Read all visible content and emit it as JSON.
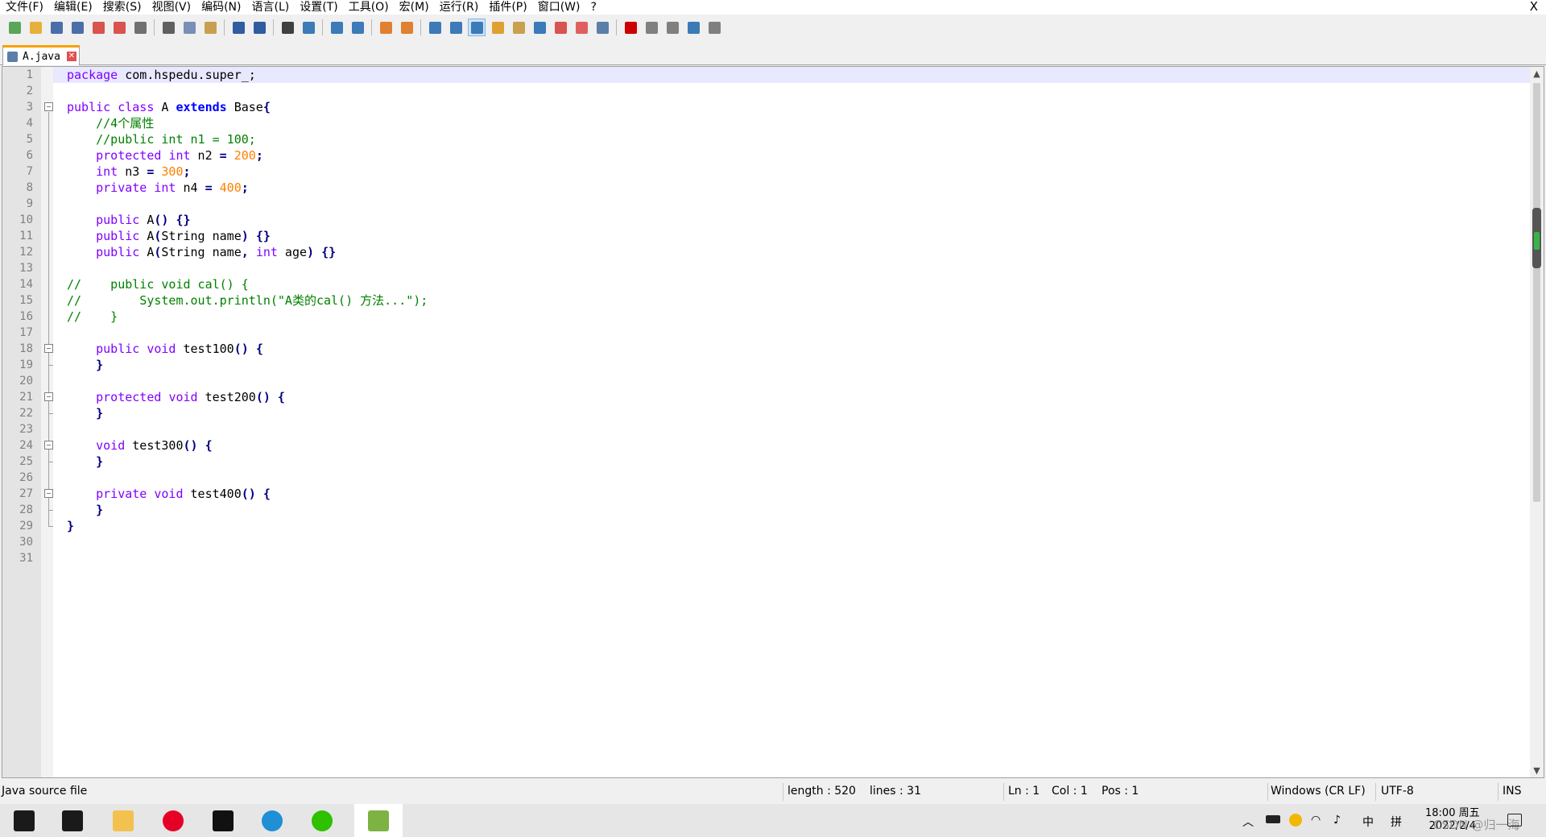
{
  "menu": {
    "items": [
      "文件(F)",
      "编辑(E)",
      "搜索(S)",
      "视图(V)",
      "编码(N)",
      "语言(L)",
      "设置(T)",
      "工具(O)",
      "宏(M)",
      "运行(R)",
      "插件(P)",
      "窗口(W)",
      "?"
    ],
    "close": "X"
  },
  "toolbar": {
    "icons": [
      {
        "name": "new-file-icon",
        "color": "#5aa55a"
      },
      {
        "name": "open-file-icon",
        "color": "#e6b13a"
      },
      {
        "name": "save-icon",
        "color": "#4a6fa8"
      },
      {
        "name": "save-all-icon",
        "color": "#4a6fa8"
      },
      {
        "name": "close-file-icon",
        "color": "#d9534f"
      },
      {
        "name": "close-all-icon",
        "color": "#d9534f"
      },
      {
        "name": "print-icon",
        "color": "#707070"
      },
      {
        "name": "sep"
      },
      {
        "name": "cut-icon",
        "color": "#606060"
      },
      {
        "name": "copy-icon",
        "color": "#7a8fb5"
      },
      {
        "name": "paste-icon",
        "color": "#c8a050"
      },
      {
        "name": "sep"
      },
      {
        "name": "undo-icon",
        "color": "#2f5d9f"
      },
      {
        "name": "redo-icon",
        "color": "#2f5d9f"
      },
      {
        "name": "sep"
      },
      {
        "name": "find-icon",
        "color": "#404040"
      },
      {
        "name": "replace-icon",
        "color": "#3c7ab8"
      },
      {
        "name": "sep"
      },
      {
        "name": "zoom-in-icon",
        "color": "#3c7ab8"
      },
      {
        "name": "zoom-out-icon",
        "color": "#3c7ab8"
      },
      {
        "name": "sep"
      },
      {
        "name": "sync-vertical-icon",
        "color": "#e08030"
      },
      {
        "name": "sync-horizontal-icon",
        "color": "#e08030"
      },
      {
        "name": "sep"
      },
      {
        "name": "word-wrap-icon",
        "color": "#3c7ab8"
      },
      {
        "name": "show-all-chars-icon",
        "color": "#3c7ab8"
      },
      {
        "name": "indent-guide-icon",
        "color": "#3c7ab8",
        "active": true
      },
      {
        "name": "udl-icon",
        "color": "#e0a030"
      },
      {
        "name": "doc-map-icon",
        "color": "#c8a050"
      },
      {
        "name": "function-list-icon",
        "color": "#3c7ab8"
      },
      {
        "name": "folder-workspace-icon",
        "color": "#d9534f"
      },
      {
        "name": "folder-icon",
        "color": "#e06060"
      },
      {
        "name": "monitoring-icon",
        "color": "#5a7fa8"
      },
      {
        "name": "sep"
      },
      {
        "name": "record-macro-icon",
        "color": "#cc0000"
      },
      {
        "name": "stop-record-icon",
        "color": "#808080"
      },
      {
        "name": "playback-macro-icon",
        "color": "#808080"
      },
      {
        "name": "run-macro-multiple-icon",
        "color": "#3c7ab8"
      },
      {
        "name": "save-macro-icon",
        "color": "#808080"
      }
    ]
  },
  "tab": {
    "name": "A.java",
    "close": "✕"
  },
  "code": {
    "lines": [
      [
        [
          "kw",
          "package"
        ],
        [
          "tx",
          " com.hspedu.super_;"
        ]
      ],
      [],
      [
        [
          "kw",
          "public"
        ],
        [
          "tx",
          " "
        ],
        [
          "kw",
          "class"
        ],
        [
          "tx",
          " A "
        ],
        [
          "kwb",
          "extends"
        ],
        [
          "tx",
          " Base"
        ],
        [
          "op",
          "{"
        ]
      ],
      [
        [
          "tx",
          "    "
        ],
        [
          "cm",
          "//4个属性"
        ]
      ],
      [
        [
          "tx",
          "    "
        ],
        [
          "cm",
          "//public int n1 = 100;"
        ]
      ],
      [
        [
          "tx",
          "    "
        ],
        [
          "kw",
          "protected"
        ],
        [
          "tx",
          " "
        ],
        [
          "kw",
          "int"
        ],
        [
          "tx",
          " n2 "
        ],
        [
          "op",
          "="
        ],
        [
          "tx",
          " "
        ],
        [
          "num",
          "200"
        ],
        [
          "op",
          ";"
        ]
      ],
      [
        [
          "tx",
          "    "
        ],
        [
          "kw",
          "int"
        ],
        [
          "tx",
          " n3 "
        ],
        [
          "op",
          "="
        ],
        [
          "tx",
          " "
        ],
        [
          "num",
          "300"
        ],
        [
          "op",
          ";"
        ]
      ],
      [
        [
          "tx",
          "    "
        ],
        [
          "kw",
          "private"
        ],
        [
          "tx",
          " "
        ],
        [
          "kw",
          "int"
        ],
        [
          "tx",
          " n4 "
        ],
        [
          "op",
          "="
        ],
        [
          "tx",
          " "
        ],
        [
          "num",
          "400"
        ],
        [
          "op",
          ";"
        ]
      ],
      [],
      [
        [
          "tx",
          "    "
        ],
        [
          "kw",
          "public"
        ],
        [
          "tx",
          " A"
        ],
        [
          "op",
          "()"
        ],
        [
          "tx",
          " "
        ],
        [
          "op",
          "{}"
        ]
      ],
      [
        [
          "tx",
          "    "
        ],
        [
          "kw",
          "public"
        ],
        [
          "tx",
          " A"
        ],
        [
          "op",
          "("
        ],
        [
          "tx",
          "String name"
        ],
        [
          "op",
          ")"
        ],
        [
          "tx",
          " "
        ],
        [
          "op",
          "{}"
        ]
      ],
      [
        [
          "tx",
          "    "
        ],
        [
          "kw",
          "public"
        ],
        [
          "tx",
          " A"
        ],
        [
          "op",
          "("
        ],
        [
          "tx",
          "String name"
        ],
        [
          "op",
          ","
        ],
        [
          "tx",
          " "
        ],
        [
          "kw",
          "int"
        ],
        [
          "tx",
          " age"
        ],
        [
          "op",
          ")"
        ],
        [
          "tx",
          " "
        ],
        [
          "op",
          "{}"
        ]
      ],
      [],
      [
        [
          "cm",
          "//    public void cal() {"
        ]
      ],
      [
        [
          "cm",
          "//        System.out.println(\"A类的cal() 方法...\");"
        ]
      ],
      [
        [
          "cm",
          "//    }"
        ]
      ],
      [],
      [
        [
          "tx",
          "    "
        ],
        [
          "kw",
          "public"
        ],
        [
          "tx",
          " "
        ],
        [
          "kw",
          "void"
        ],
        [
          "tx",
          " test100"
        ],
        [
          "op",
          "()"
        ],
        [
          "tx",
          " "
        ],
        [
          "op",
          "{"
        ]
      ],
      [
        [
          "tx",
          "    "
        ],
        [
          "op",
          "}"
        ]
      ],
      [],
      [
        [
          "tx",
          "    "
        ],
        [
          "kw",
          "protected"
        ],
        [
          "tx",
          " "
        ],
        [
          "kw",
          "void"
        ],
        [
          "tx",
          " test200"
        ],
        [
          "op",
          "()"
        ],
        [
          "tx",
          " "
        ],
        [
          "op",
          "{"
        ]
      ],
      [
        [
          "tx",
          "    "
        ],
        [
          "op",
          "}"
        ]
      ],
      [],
      [
        [
          "tx",
          "    "
        ],
        [
          "kw",
          "void"
        ],
        [
          "tx",
          " test300"
        ],
        [
          "op",
          "()"
        ],
        [
          "tx",
          " "
        ],
        [
          "op",
          "{"
        ]
      ],
      [
        [
          "tx",
          "    "
        ],
        [
          "op",
          "}"
        ]
      ],
      [],
      [
        [
          "tx",
          "    "
        ],
        [
          "kw",
          "private"
        ],
        [
          "tx",
          " "
        ],
        [
          "kw",
          "void"
        ],
        [
          "tx",
          " test400"
        ],
        [
          "op",
          "()"
        ],
        [
          "tx",
          " "
        ],
        [
          "op",
          "{"
        ]
      ],
      [
        [
          "tx",
          "    "
        ],
        [
          "op",
          "}"
        ]
      ],
      [
        [
          "op",
          "}"
        ]
      ],
      [],
      []
    ],
    "line_numbers": [
      "1",
      "2",
      "3",
      "4",
      "5",
      "6",
      "7",
      "8",
      "9",
      "10",
      "11",
      "12",
      "13",
      "14",
      "15",
      "16",
      "17",
      "18",
      "19",
      "20",
      "21",
      "22",
      "23",
      "24",
      "25",
      "26",
      "27",
      "28",
      "29",
      "30",
      "31"
    ],
    "current_line": 1
  },
  "status": {
    "file_type": "Java source file",
    "length": "length : 520",
    "lines": "lines : 31",
    "ln": "Ln : 1",
    "col": "Col : 1",
    "pos": "Pos : 1",
    "eol": "Windows (CR LF)",
    "encoding": "UTF-8",
    "mode": "INS"
  },
  "taskbar": {
    "apps": [
      {
        "name": "windows-start-icon",
        "color": "#1a1a1a"
      },
      {
        "name": "search-icon",
        "color": "#1a1a1a"
      },
      {
        "name": "file-explorer-icon",
        "color": "#f2c14e"
      },
      {
        "name": "netease-music-icon",
        "color": "#e60026"
      },
      {
        "name": "typora-icon",
        "color": "#111111"
      },
      {
        "name": "edge-browser-icon",
        "color": "#1f8fd6"
      },
      {
        "name": "wechat-icon",
        "color": "#2dc100"
      },
      {
        "name": "notepadpp-icon",
        "color": "#7cb342",
        "active": true
      }
    ],
    "tray": {
      "input_lang": "中",
      "keyboard": "拼",
      "time": "18:00 周五",
      "date": "2022/2/4",
      "watermark": "CSDN @归一海"
    }
  }
}
